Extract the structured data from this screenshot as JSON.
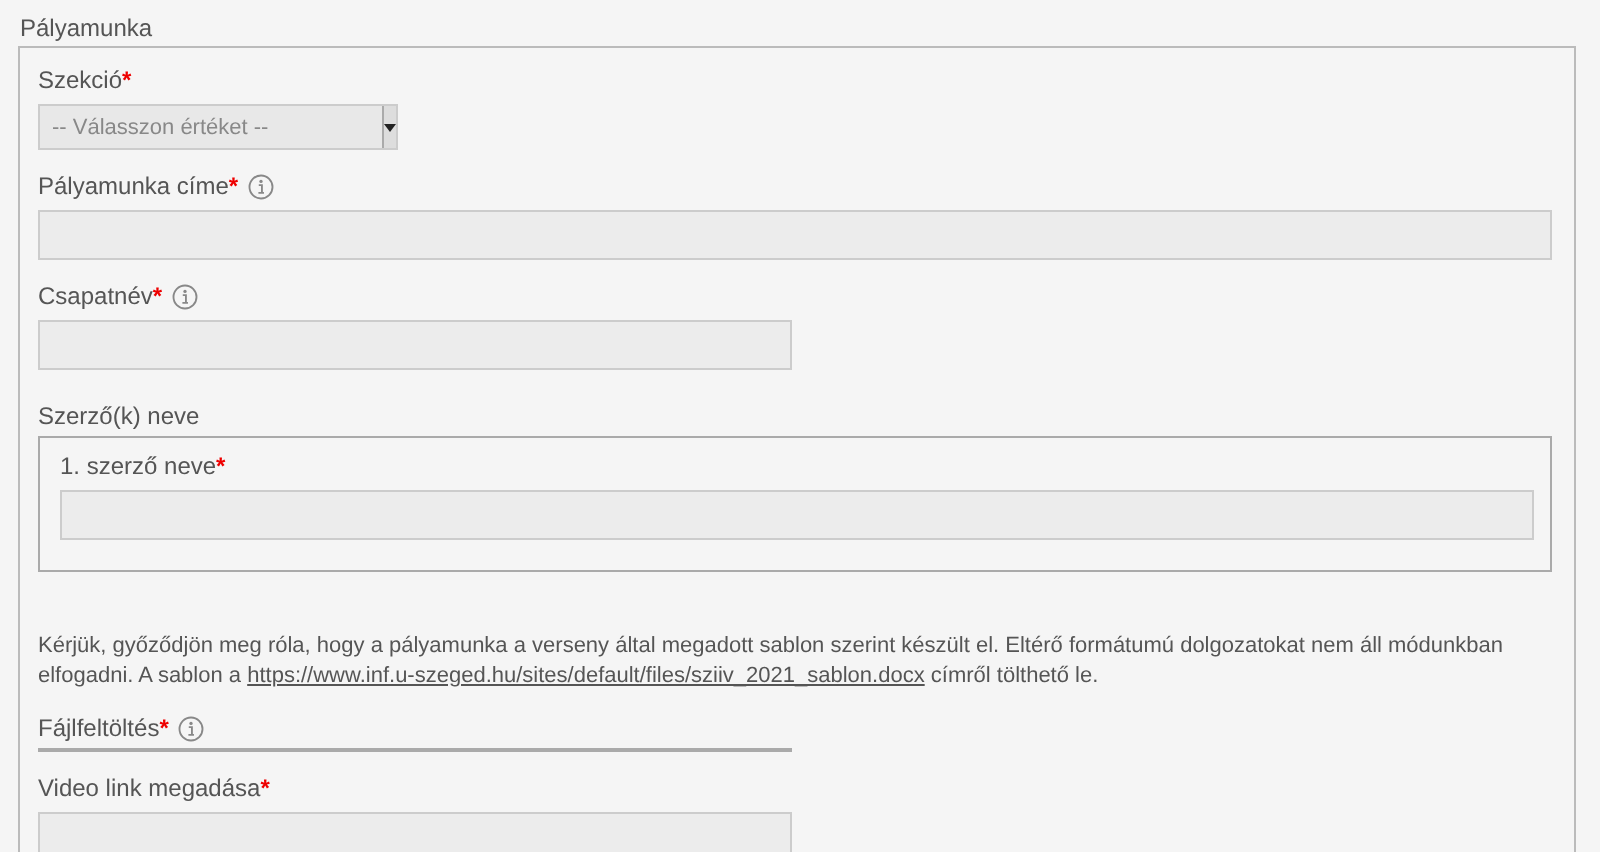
{
  "section": {
    "legend": "Pályamunka",
    "fields": [
      {
        "kind": "select",
        "label": "Szekció",
        "required_mark": "*",
        "info": false,
        "value": "-- Válasszon értéket --"
      },
      {
        "kind": "wide_text",
        "label": "Pályamunka címe",
        "required_mark": "*",
        "info": true
      },
      {
        "kind": "text",
        "label": "Csapatnév",
        "required_mark": "*",
        "info": true
      },
      {
        "kind": "group",
        "legend": "Szerző(k) neve",
        "children": [
          {
            "kind": "wide_text",
            "label": "1. szerző neve",
            "required_mark": "*",
            "info": false
          }
        ]
      },
      {
        "kind": "notice",
        "before": "Kérjük, győződjön meg róla, hogy a pályamunka a verseny által megadott sablon szerint készült el. Eltérő formátumú dolgozatokat nem áll módunkban elfogadni. A sablon a ",
        "link": "https://www.inf.u-szeged.hu/sites/default/files/sziiv_2021_sablon.docx",
        "after": " címről tölthető le."
      },
      {
        "kind": "upload",
        "label": "Fájlfeltöltés",
        "required_mark": "*",
        "info": true
      },
      {
        "kind": "text",
        "label": "Video link megadása",
        "required_mark": "*",
        "info": false
      }
    ]
  }
}
